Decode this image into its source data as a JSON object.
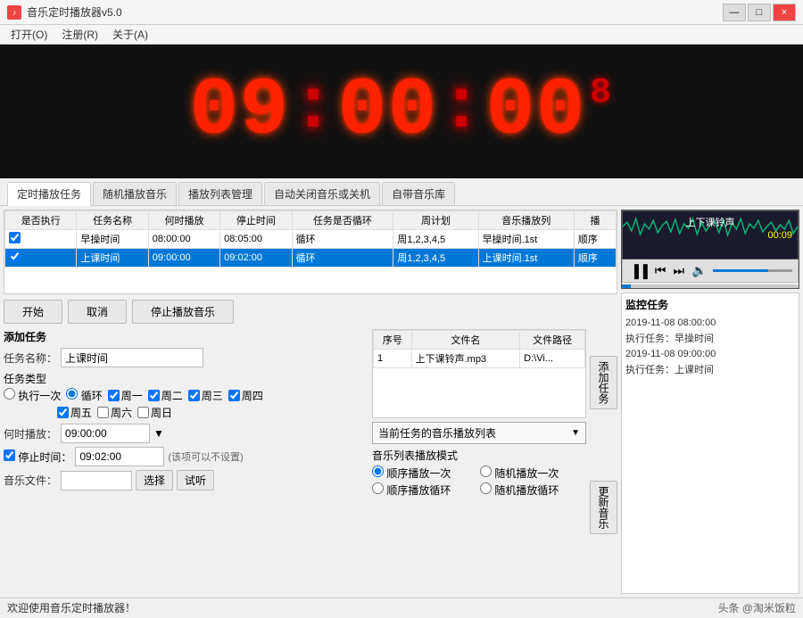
{
  "window": {
    "title": "音乐定时播放器v5.0",
    "controls": [
      "—",
      "□",
      "×"
    ]
  },
  "menu": {
    "items": [
      "打开(O)",
      "注册(R)",
      "关于(A)"
    ]
  },
  "clock": {
    "hours": "09",
    "minutes": "00",
    "seconds": "00",
    "extra": "8"
  },
  "tabs": {
    "items": [
      "定时播放任务",
      "随机播放音乐",
      "播放列表管理",
      "自动关闭音乐或关机",
      "自带音乐库"
    ]
  },
  "task_table": {
    "headers": [
      "是否执行",
      "任务名称",
      "何时播放",
      "停止时间",
      "任务是否循环",
      "周计划",
      "音乐播放列",
      "播"
    ],
    "rows": [
      {
        "execute": true,
        "name": "早操时间",
        "start": "08:00:00",
        "stop": "08:05:00",
        "loop": "循环",
        "week": "周1,2,3,4,5",
        "music": "早操时间.1st",
        "order": "顺序",
        "selected": false
      },
      {
        "execute": true,
        "name": "上课时间",
        "start": "09:00:00",
        "stop": "09:02:00",
        "loop": "循环",
        "week": "周1,2,3,4,5",
        "music": "上课时间.1st",
        "order": "顺序",
        "selected": true
      }
    ]
  },
  "buttons": {
    "start": "开始",
    "cancel": "取消",
    "stop_music": "停止播放音乐"
  },
  "add_task": {
    "label": "添加任务",
    "name_label": "任务名称：",
    "name_value": "上课时间",
    "type_label": "任务类型",
    "type_once": "执行一次",
    "type_loop": "循环",
    "weekdays": [
      "周一",
      "周二",
      "周三",
      "周四",
      "周五",
      "周六",
      "周日"
    ],
    "weekday_checks": [
      true,
      true,
      true,
      true,
      true,
      false,
      false
    ],
    "time_label": "何时播放：",
    "time_value": "09:00:00",
    "stop_label": "□ 停止时间：",
    "stop_value": "09:02:00",
    "stop_hint": "(该项可以不设置)",
    "music_label": "音乐文件：",
    "select_btn": "选择",
    "preview_btn": "试听"
  },
  "file_list": {
    "headers": [
      "序号",
      "文件名",
      "文件路径"
    ],
    "rows": [
      {
        "no": "1",
        "name": "上下课铃声.mp3",
        "path": "D:\\Vi..."
      }
    ],
    "current_label": "当前任务的音乐播放列表"
  },
  "play_mode": {
    "label": "音乐列表播放模式",
    "options": [
      "顺序播放一次",
      "随机播放一次",
      "顺序播放循环",
      "随机播放循环"
    ],
    "selected": "顺序播放一次"
  },
  "add_task_btn": "添加任务",
  "update_music_btn": "更新音乐",
  "player": {
    "track_name": "上下课铃声",
    "time": "00:09"
  },
  "monitor": {
    "title": "监控任务",
    "logs": [
      "2019-11-08 08:00:00",
      "执行任务：早操时间",
      "2019-11-08 09:00:00",
      "执行任务：上课时间"
    ]
  },
  "status_bar": {
    "message": "欢迎使用音乐定时播放器！",
    "watermark": "头条 @淘米饭粒"
  }
}
